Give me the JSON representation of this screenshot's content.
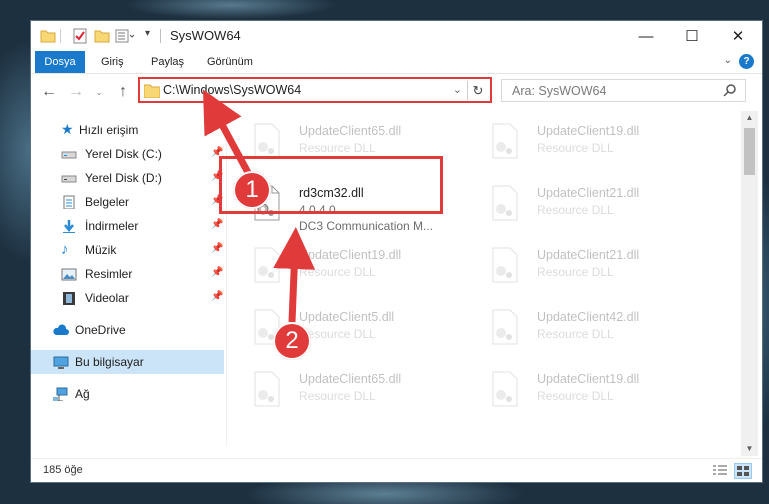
{
  "window": {
    "title": "SysWOW64",
    "controls": {
      "minimize": "—",
      "maximize": "☐",
      "close": "✕"
    }
  },
  "ribbon": {
    "tabs": [
      "Dosya",
      "Giriş",
      "Paylaş",
      "Görünüm"
    ],
    "help": "?"
  },
  "address_bar": {
    "path": "C:\\Windows\\SysWOW64",
    "search_placeholder": "Ara: SysWOW64"
  },
  "sidebar": {
    "items": [
      {
        "label": "Hızlı erişim",
        "icon": "star-icon",
        "pinned": false
      },
      {
        "label": "Yerel Disk (C:)",
        "icon": "drive-icon",
        "pinned": true
      },
      {
        "label": "Yerel Disk (D:)",
        "icon": "drive-icon",
        "pinned": true
      },
      {
        "label": "Belgeler",
        "icon": "documents-icon",
        "pinned": true
      },
      {
        "label": "İndirmeler",
        "icon": "download-icon",
        "pinned": true
      },
      {
        "label": "Müzik",
        "icon": "music-icon",
        "pinned": true
      },
      {
        "label": "Resimler",
        "icon": "pictures-icon",
        "pinned": true
      },
      {
        "label": "Videolar",
        "icon": "video-icon",
        "pinned": true
      },
      {
        "label": "OneDrive",
        "icon": "cloud-icon",
        "pinned": false
      },
      {
        "label": "Bu bilgisayar",
        "icon": "computer-icon",
        "pinned": false,
        "selected": true
      },
      {
        "label": "Ağ",
        "icon": "network-icon",
        "pinned": false
      }
    ]
  },
  "files": {
    "left_column": [
      {
        "name": "UpdateClient65.dll",
        "desc": "Resource DLL"
      },
      {
        "name": "rd3cm32.dll",
        "version": "4.0.4.0",
        "desc": "DC3 Communication M...",
        "highlighted": true
      },
      {
        "name": "UpdateClient19.dll",
        "desc": "Resource DLL"
      },
      {
        "name": "UpdateClient5.dll",
        "desc": "Resource DLL"
      },
      {
        "name": "UpdateClient65.dll",
        "desc": "Resource DLL"
      }
    ],
    "right_column": [
      {
        "name": "UpdateClient19.dll",
        "desc": "Resource DLL"
      },
      {
        "name": "UpdateClient21.dll",
        "desc": "Resource DLL"
      },
      {
        "name": "UpdateClient21.dll",
        "desc": "Resource DLL"
      },
      {
        "name": "UpdateClient42.dll",
        "desc": "Resource DLL"
      },
      {
        "name": "UpdateClient19.dll",
        "desc": "Resource DLL"
      }
    ]
  },
  "status_bar": {
    "item_count": "185 öğe"
  },
  "annotations": {
    "step1": "1",
    "step2": "2",
    "color": "#e03a3a"
  },
  "colors": {
    "accent": "#1979ca",
    "selection": "#cce4f7",
    "folder": "#f8d775"
  }
}
